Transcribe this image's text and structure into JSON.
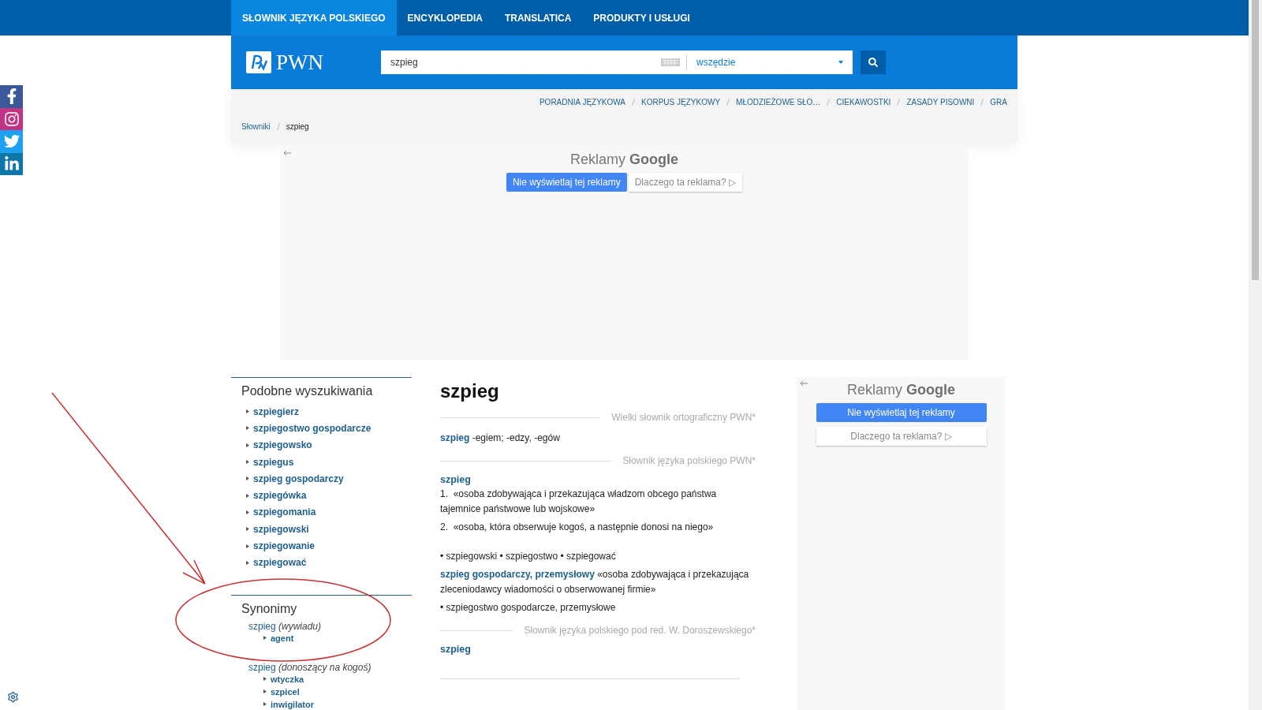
{
  "nav": {
    "tabs": [
      {
        "label": "SŁOWNIK JĘZYKA POLSKIEGO",
        "selected": true
      },
      {
        "label": "ENCYKLOPEDIA",
        "selected": false
      },
      {
        "label": "TRANSLATICA",
        "selected": false
      },
      {
        "label": "PRODUKTY I USŁUGI",
        "selected": false
      }
    ]
  },
  "logo": {
    "text": "PWN"
  },
  "search": {
    "value": "szpieg",
    "scope": "wszędzie"
  },
  "links": [
    "PORADNIA JĘZYKOWA",
    "KORPUS JĘZYKOWY",
    "MŁODZIEŻOWE SŁO…",
    "CIEKAWOSTKI",
    "ZASADY PISOWNI",
    "GRA"
  ],
  "breadcrumb": [
    {
      "label": "Słowniki",
      "current": false
    },
    {
      "label": "szpieg",
      "current": true
    }
  ],
  "ads": [
    {
      "title": "Reklamy",
      "brand": "Google",
      "hide": "Nie wyświetlaj tej reklamy",
      "why": "Dlaczego ta reklama? ▷"
    },
    {
      "title": "Reklamy",
      "brand": "Google",
      "hide": "Nie wyświetlaj tej reklamy",
      "why": "Dlaczego ta reklama? ▷"
    }
  ],
  "similar": {
    "title": "Podobne wyszukiwania",
    "items": [
      "szpiegierz",
      "szpiegostwo gospodarcze",
      "szpiegowsko",
      "szpiegus",
      "szpieg gospodarczy",
      "szpiegówka",
      "szpiegomania",
      "szpiegowski",
      "szpiegowanie",
      "szpiegować"
    ]
  },
  "synonyms": {
    "title": "Synonimy",
    "groups": [
      {
        "word": "szpieg",
        "sense": "(wywiadu)",
        "children": [
          "agent"
        ]
      },
      {
        "word": "szpieg",
        "sense": "(donoszący na kogoś)",
        "children": [
          "wtyczka",
          "szpicel",
          "inwigilator"
        ]
      }
    ]
  },
  "entry": {
    "title": "szpieg",
    "sections": [
      {
        "source": "Wielki słownik ortograficzny PWN*",
        "blocks": [
          {
            "kind": "inline",
            "head": "szpieg",
            "text": " -egiem; -edzy, -egów"
          }
        ]
      },
      {
        "source": "Słownik języka polskiego PWN*",
        "blocks": [
          {
            "kind": "head",
            "text": "szpieg"
          },
          {
            "kind": "definition",
            "number": "1.",
            "text": "«osoba zdobywająca i przekazująca władzom obcego państwa tajemnice państwowe lub wojskowe»"
          },
          {
            "kind": "definition",
            "number": "2.",
            "text": "«osoba, która obserwuje kogoś, a następnie donosi na niego»"
          },
          {
            "kind": "derivatives",
            "text": "• szpiegowski • szpiegostwo • szpiegować"
          },
          {
            "kind": "inline",
            "head": "szpieg gospodarczy, przemysłowy",
            "text": " «osoba zdobywająca i przekazująca zleceniodawcy wiadomości o obserwowanej firmie»"
          },
          {
            "kind": "plain",
            "text": "• szpiegostwo gospodarcze, przemysłowe"
          }
        ]
      },
      {
        "source": "Słownik języka polskiego pod red. W. Doroszewskiego*",
        "blocks": [
          {
            "kind": "head",
            "text": "szpieg"
          }
        ]
      }
    ]
  }
}
